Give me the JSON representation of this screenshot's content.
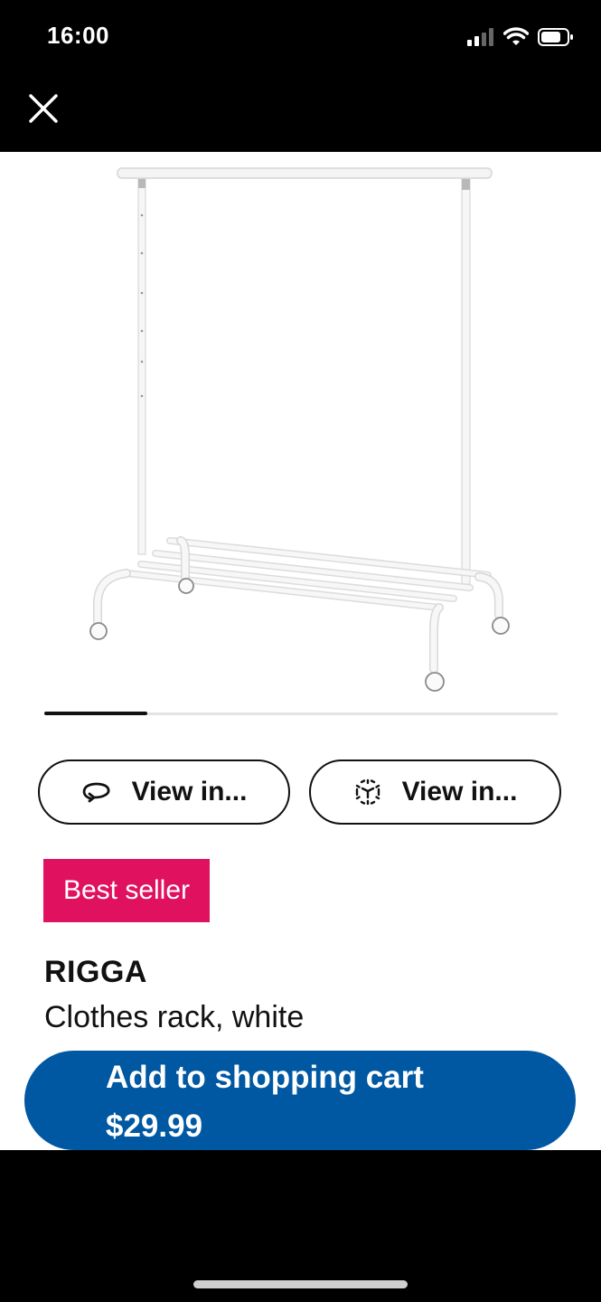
{
  "status_bar": {
    "time": "16:00",
    "icons": [
      "cellular-signal-icon",
      "wifi-icon",
      "battery-icon"
    ]
  },
  "header": {
    "close_icon": "close-icon"
  },
  "gallery": {
    "image_count_progress": 0.2
  },
  "actions": {
    "view_in_room_label": "View in...",
    "view_in_room_icon": "rotate-360-icon",
    "view_in_ar_label": "View in...",
    "view_in_ar_icon": "ar-cube-icon"
  },
  "product": {
    "badge": "Best seller",
    "badge_color": "#e0115f",
    "name": "RIGGA",
    "description": "Clothes rack, white"
  },
  "cart": {
    "label": "Add to shopping cart",
    "price": "$29.99",
    "color": "#0058a3"
  }
}
